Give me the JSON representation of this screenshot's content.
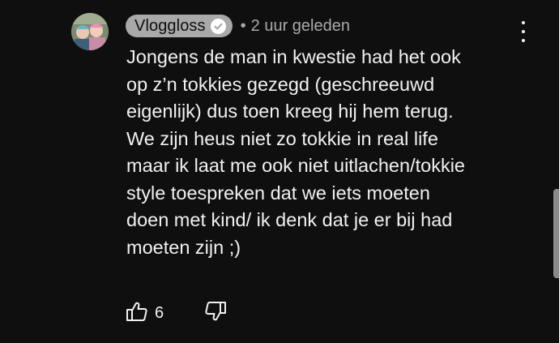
{
  "comment": {
    "author": "Vloggloss",
    "verified_icon": "checkmark-circle-icon",
    "separator": "•",
    "timestamp": "2 uur geleden",
    "body": "Jongens de man in kwestie had het ook\nop z’n tokkies gezegd (geschreeuwd\neigenlijk) dus toen kreeg hij hem terug.\nWe zijn heus niet zo tokkie in real life\nmaar ik laat me ook niet uitlachen/tokkie\nstyle toespreken dat we iets moeten\ndoen met kind/ ik denk dat je er bij had\nmoeten zijn ;)",
    "like_count": "6",
    "like_icon": "thumbs-up-icon",
    "dislike_icon": "thumbs-down-icon",
    "menu_icon": "more-vertical-icon"
  },
  "colors": {
    "background": "#0f0f0f",
    "text": "#f1f1f1",
    "secondary_text": "#aaaaaa",
    "author_chip": "#a9a9a9"
  }
}
